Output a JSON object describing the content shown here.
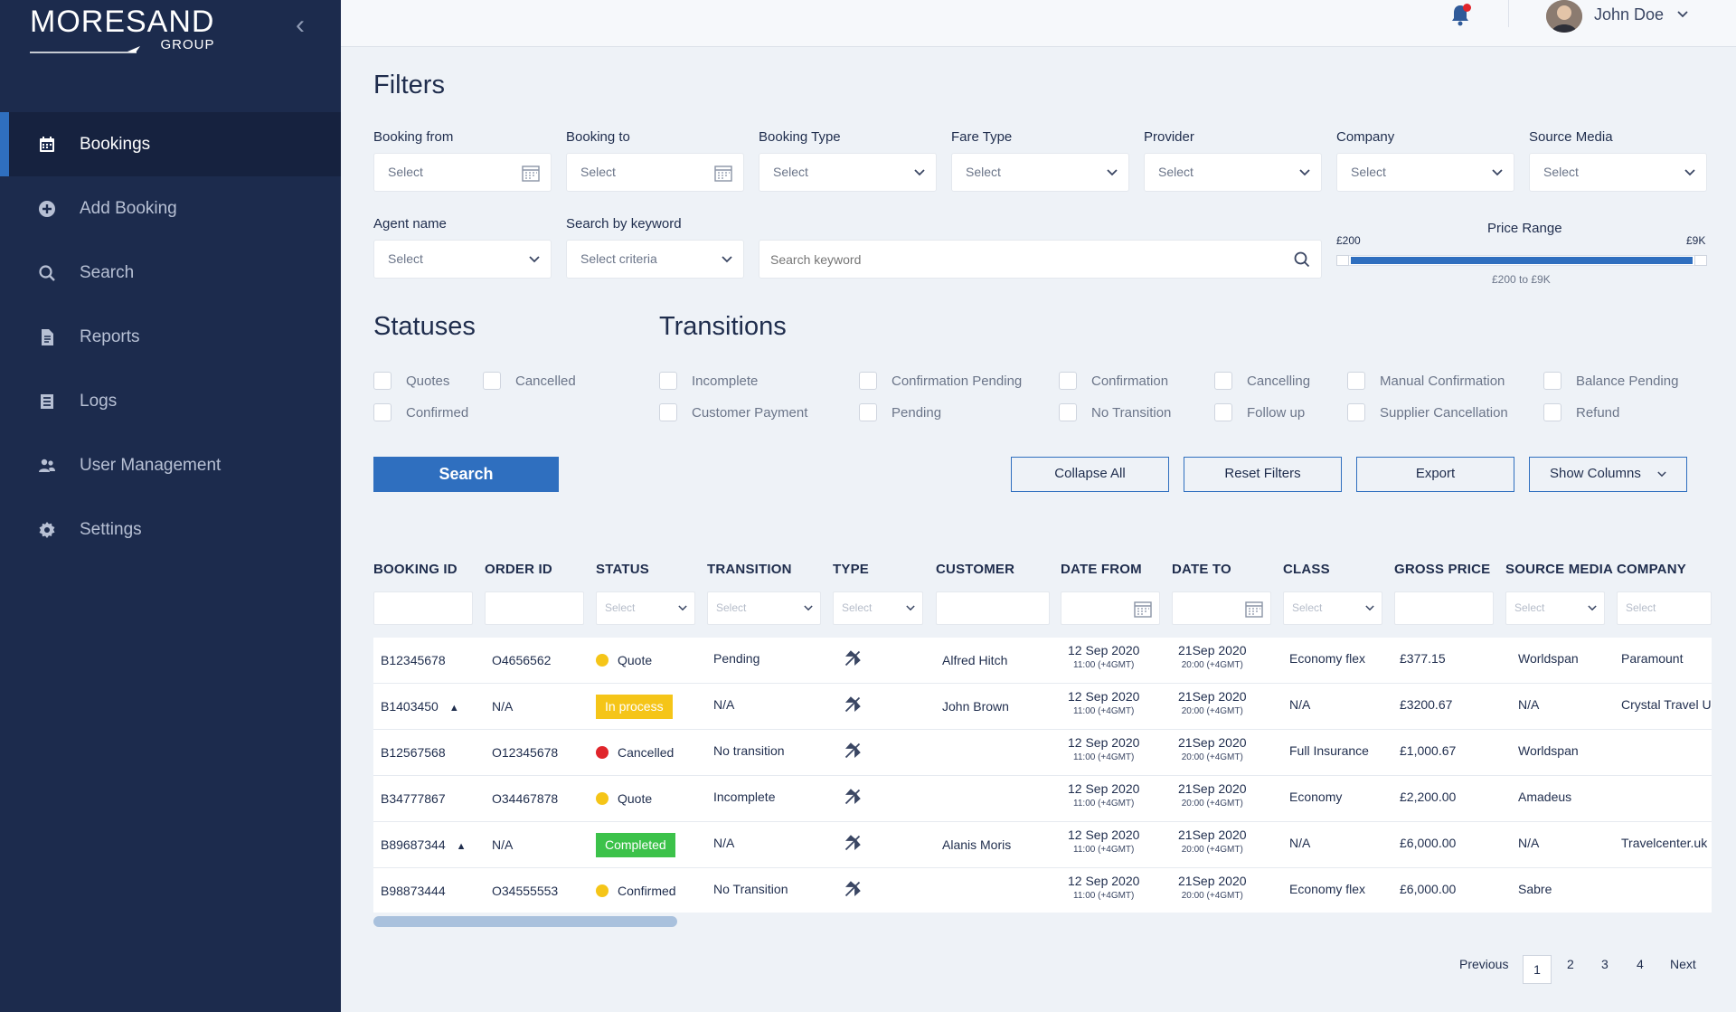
{
  "brand": {
    "name": "MORESAND",
    "sub": "GROUP"
  },
  "sidebar": {
    "items": [
      {
        "label": "Bookings",
        "icon": "calendar-icon"
      },
      {
        "label": "Add Booking",
        "icon": "plus-circle-icon"
      },
      {
        "label": "Search",
        "icon": "search-icon"
      },
      {
        "label": "Reports",
        "icon": "file-icon"
      },
      {
        "label": "Logs",
        "icon": "log-icon"
      },
      {
        "label": "User Management",
        "icon": "users-icon"
      },
      {
        "label": "Settings",
        "icon": "gear-icon"
      }
    ]
  },
  "user": {
    "name": "John Doe"
  },
  "filters": {
    "title": "Filters",
    "booking_from": {
      "label": "Booking from",
      "value": "Select"
    },
    "booking_to": {
      "label": "Booking to",
      "value": "Select"
    },
    "booking_type": {
      "label": "Booking Type",
      "value": "Select"
    },
    "fare_type": {
      "label": "Fare Type",
      "value": "Select"
    },
    "provider": {
      "label": "Provider",
      "value": "Select"
    },
    "company": {
      "label": "Company",
      "value": "Select"
    },
    "source_media": {
      "label": "Source Media",
      "value": "Select"
    },
    "agent_name": {
      "label": "Agent name",
      "value": "Select"
    },
    "search_by": {
      "label": "Search by keyword",
      "value": "Select criteria"
    },
    "keyword_placeholder": "Search keyword",
    "price": {
      "label": "Price Range",
      "min": "£200",
      "max": "£9K",
      "text": "£200 to £9K"
    }
  },
  "statuses": {
    "title": "Statuses",
    "items": [
      "Quotes",
      "Cancelled",
      "Confirmed"
    ]
  },
  "transitions": {
    "title": "Transitions",
    "items": [
      "Incomplete",
      "Customer Payment",
      "Confirmation Pending",
      "Pending",
      "Confirmation",
      "No Transition",
      "Cancelling",
      "Follow up",
      "Manual Confirmation",
      "Supplier Cancellation",
      "Balance Pending",
      "Refund"
    ]
  },
  "actions": {
    "search": "Search",
    "collapse_all": "Collapse All",
    "reset_filters": "Reset Filters",
    "export": "Export",
    "show_columns": "Show Columns"
  },
  "table": {
    "columns": [
      "BOOKING ID",
      "ORDER ID",
      "STATUS",
      "TRANSITION",
      "TYPE",
      "CUSTOMER",
      "DATE FROM",
      "DATE TO",
      "CLASS",
      "GROSS PRICE",
      "SOURCE MEDIA",
      "COMPANY"
    ],
    "filter_placeholder": "Select",
    "rows": [
      {
        "booking_id": "B12345678",
        "expand": false,
        "order_id": "O4656562",
        "status": "Quote",
        "status_style": "dot",
        "status_color": "#f5c518",
        "transition": "Pending",
        "customer": "Alfred Hitch",
        "date_from": "12 Sep 2020",
        "date_from_time": "11:00 (+4GMT)",
        "date_to": "21Sep 2020",
        "date_to_time": "20:00 (+4GMT)",
        "class": "Economy flex",
        "price": "£377.15",
        "source": "Worldspan",
        "company": "Paramount"
      },
      {
        "booking_id": "B1403450",
        "expand": true,
        "order_id": "N/A",
        "status": "In process",
        "status_style": "badge",
        "status_color": "#f5c518",
        "transition": "N/A",
        "customer": "John Brown",
        "date_from": "12 Sep 2020",
        "date_from_time": "11:00 (+4GMT)",
        "date_to": "21Sep 2020",
        "date_to_time": "20:00 (+4GMT)",
        "class": "N/A",
        "price": "£3200.67",
        "source": "N/A",
        "company": "Crystal Travel U"
      },
      {
        "booking_id": "B12567568",
        "expand": false,
        "order_id": "O12345678",
        "status": "Cancelled",
        "status_style": "dot",
        "status_color": "#e0252b",
        "transition": "No transition",
        "customer": "",
        "date_from": "12 Sep 2020",
        "date_from_time": "11:00 (+4GMT)",
        "date_to": "21Sep 2020",
        "date_to_time": "20:00 (+4GMT)",
        "class": "Full Insurance",
        "price": "£1,000.67",
        "source": "Worldspan",
        "company": ""
      },
      {
        "booking_id": "B34777867",
        "expand": false,
        "order_id": "O34467878",
        "status": "Quote",
        "status_style": "dot",
        "status_color": "#f5c518",
        "transition": "Incomplete",
        "customer": "",
        "date_from": "12 Sep 2020",
        "date_from_time": "11:00 (+4GMT)",
        "date_to": "21Sep 2020",
        "date_to_time": "20:00 (+4GMT)",
        "class": "Economy",
        "price": "£2,200.00",
        "source": "Amadeus",
        "company": ""
      },
      {
        "booking_id": "B89687344",
        "expand": true,
        "order_id": "N/A",
        "status": "Completed",
        "status_style": "badge",
        "status_color": "#3cc24a",
        "transition": "N/A",
        "customer": "Alanis Moris",
        "date_from": "12 Sep 2020",
        "date_from_time": "11:00 (+4GMT)",
        "date_to": "21Sep 2020",
        "date_to_time": "20:00 (+4GMT)",
        "class": "N/A",
        "price": "£6,000.00",
        "source": "N/A",
        "company": "Travelcenter.uk"
      },
      {
        "booking_id": "B98873444",
        "expand": false,
        "order_id": "O34555553",
        "status": "Confirmed",
        "status_style": "dot",
        "status_color": "#f5c518",
        "transition": "No Transition",
        "customer": "",
        "date_from": "12 Sep 2020",
        "date_from_time": "11:00 (+4GMT)",
        "date_to": "21Sep 2020",
        "date_to_time": "20:00 (+4GMT)",
        "class": "Economy flex",
        "price": "£6,000.00",
        "source": "Sabre",
        "company": ""
      }
    ]
  },
  "pagination": {
    "previous": "Previous",
    "pages": [
      "1",
      "2",
      "3",
      "4"
    ],
    "current": "1",
    "next": "Next"
  },
  "colors": {
    "sidebar": "#1c2b4d",
    "accent": "#2f6fbf",
    "background": "#eef2f7"
  }
}
